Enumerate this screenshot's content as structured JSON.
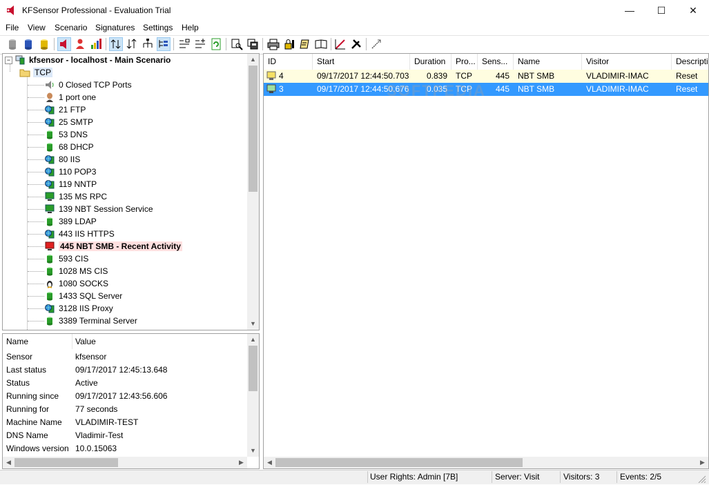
{
  "window": {
    "title": "KFSensor Professional - Evaluation Trial",
    "minimize": "—",
    "maximize": "☐",
    "close": "✕"
  },
  "menu": [
    "File",
    "View",
    "Scenario",
    "Signatures",
    "Settings",
    "Help"
  ],
  "tree": {
    "root": "kfsensor - localhost - Main Scenario",
    "folder": "TCP",
    "items": [
      {
        "port": "0",
        "name": "Closed TCP Ports",
        "icon": "speaker-icon"
      },
      {
        "port": "1",
        "name": "port one",
        "icon": "person-icon"
      },
      {
        "port": "21",
        "name": "FTP",
        "icon": "globe-server-icon"
      },
      {
        "port": "25",
        "name": "SMTP",
        "icon": "globe-server-icon"
      },
      {
        "port": "53",
        "name": "DNS",
        "icon": "database-icon"
      },
      {
        "port": "68",
        "name": "DHCP",
        "icon": "database-icon"
      },
      {
        "port": "80",
        "name": "IIS",
        "icon": "globe-server-icon"
      },
      {
        "port": "110",
        "name": "POP3",
        "icon": "globe-server-icon"
      },
      {
        "port": "119",
        "name": "NNTP",
        "icon": "globe-server-icon"
      },
      {
        "port": "135",
        "name": "MS RPC",
        "icon": "monitor-icon"
      },
      {
        "port": "139",
        "name": "NBT Session Service",
        "icon": "monitor-icon"
      },
      {
        "port": "389",
        "name": "LDAP",
        "icon": "database-icon"
      },
      {
        "port": "443",
        "name": "IIS HTTPS",
        "icon": "globe-server-icon"
      },
      {
        "port": "445",
        "name": "NBT SMB  - Recent Activity",
        "icon": "monitor-alert-icon",
        "active": true
      },
      {
        "port": "593",
        "name": "CIS",
        "icon": "database-icon"
      },
      {
        "port": "1028",
        "name": "MS CIS",
        "icon": "database-icon"
      },
      {
        "port": "1080",
        "name": "SOCKS",
        "icon": "linux-icon"
      },
      {
        "port": "1433",
        "name": "SQL Server",
        "icon": "database-icon"
      },
      {
        "port": "3128",
        "name": "IIS Proxy",
        "icon": "globe-server-icon"
      },
      {
        "port": "3389",
        "name": "Terminal Server",
        "icon": "database-icon"
      }
    ]
  },
  "properties": {
    "headers": {
      "name": "Name",
      "value": "Value"
    },
    "rows": [
      {
        "name": "Sensor",
        "value": "kfsensor"
      },
      {
        "name": "Last status",
        "value": "09/17/2017 12:45:13.648"
      },
      {
        "name": "Status",
        "value": "Active"
      },
      {
        "name": "Running since",
        "value": "09/17/2017 12:43:56.606"
      },
      {
        "name": "Running for",
        "value": "77 seconds"
      },
      {
        "name": "Machine Name",
        "value": "VLADIMIR-TEST"
      },
      {
        "name": "DNS Name",
        "value": "Vladimir-Test"
      },
      {
        "name": "Windows version",
        "value": "10.0.15063"
      }
    ]
  },
  "events": {
    "columns": [
      "ID",
      "Start",
      "Duration",
      "Pro...",
      "Sens...",
      "Name",
      "Visitor",
      "Descripti"
    ],
    "rows": [
      {
        "id": "4",
        "start": "09/17/2017 12:44:50.703",
        "duration": "0.839",
        "protocol": "TCP",
        "sensor": "445",
        "name": "NBT SMB",
        "visitor": "VLADIMIR-IMAC",
        "description": "Reset",
        "state": "highlight"
      },
      {
        "id": "3",
        "start": "09/17/2017 12:44:50.676",
        "duration": "0.035",
        "protocol": "TCP",
        "sensor": "445",
        "name": "NBT SMB",
        "visitor": "VLADIMIR-IMAC",
        "description": "Reset",
        "state": "selected"
      }
    ],
    "watermark": "SOFTPEDIA"
  },
  "status": {
    "user_rights": "User Rights: Admin [7B]",
    "server": "Server: Visit",
    "visitors": "Visitors: 3",
    "events": "Events: 2/5"
  },
  "colors": {
    "highlight_row": "#fffde0",
    "selected_row": "#3399ff",
    "active_item": "#ffe0e0"
  }
}
